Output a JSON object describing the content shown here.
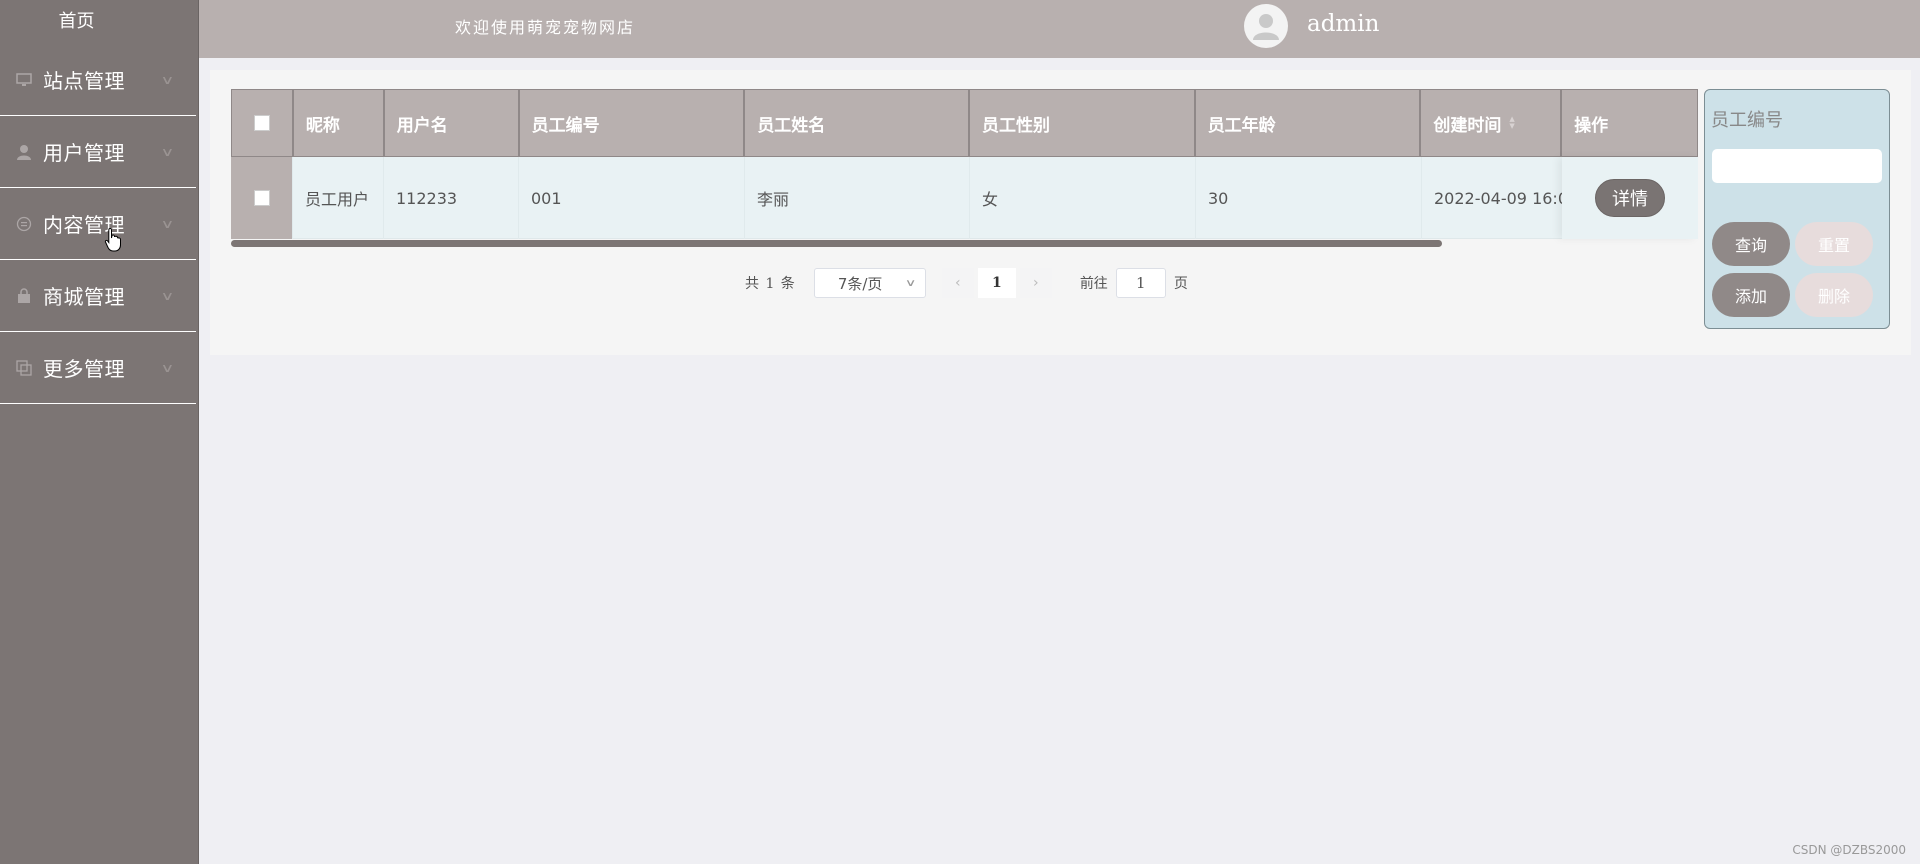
{
  "header": {
    "welcome": "欢迎使用萌宠宠物网店",
    "username": "admin"
  },
  "sidebar": {
    "home": "首页",
    "items": [
      {
        "label": "站点管理",
        "icon": "monitor-icon"
      },
      {
        "label": "用户管理",
        "icon": "user-icon"
      },
      {
        "label": "内容管理",
        "icon": "chat-icon"
      },
      {
        "label": "商城管理",
        "icon": "shopping-bag-icon"
      },
      {
        "label": "更多管理",
        "icon": "copy-icon"
      }
    ]
  },
  "table": {
    "headers": [
      "昵称",
      "用户名",
      "员工编号",
      "员工姓名",
      "员工性别",
      "员工年龄",
      "创建时间",
      "操作"
    ],
    "rows": [
      {
        "nickname": "员工用户",
        "username": "112233",
        "employee_no": "001",
        "name": "李丽",
        "gender": "女",
        "age": "30",
        "created": "2022-04-09 16:0",
        "action": "详情"
      }
    ]
  },
  "pagination": {
    "total": "共 1 条",
    "page_size": "7条/页",
    "current_page": "1",
    "goto_prefix": "前往",
    "goto_value": "1",
    "goto_suffix": "页"
  },
  "search_panel": {
    "label": "员工编号",
    "query": "查询",
    "reset": "重置",
    "add": "添加",
    "delete": "删除"
  },
  "colors": {
    "sidebar_bg": "#7c7574",
    "header_bg": "#b8b0af",
    "row_bg": "#e9f2f4",
    "search_panel_bg": "#cde1e8"
  },
  "watermark": "CSDN @DZBS2000"
}
